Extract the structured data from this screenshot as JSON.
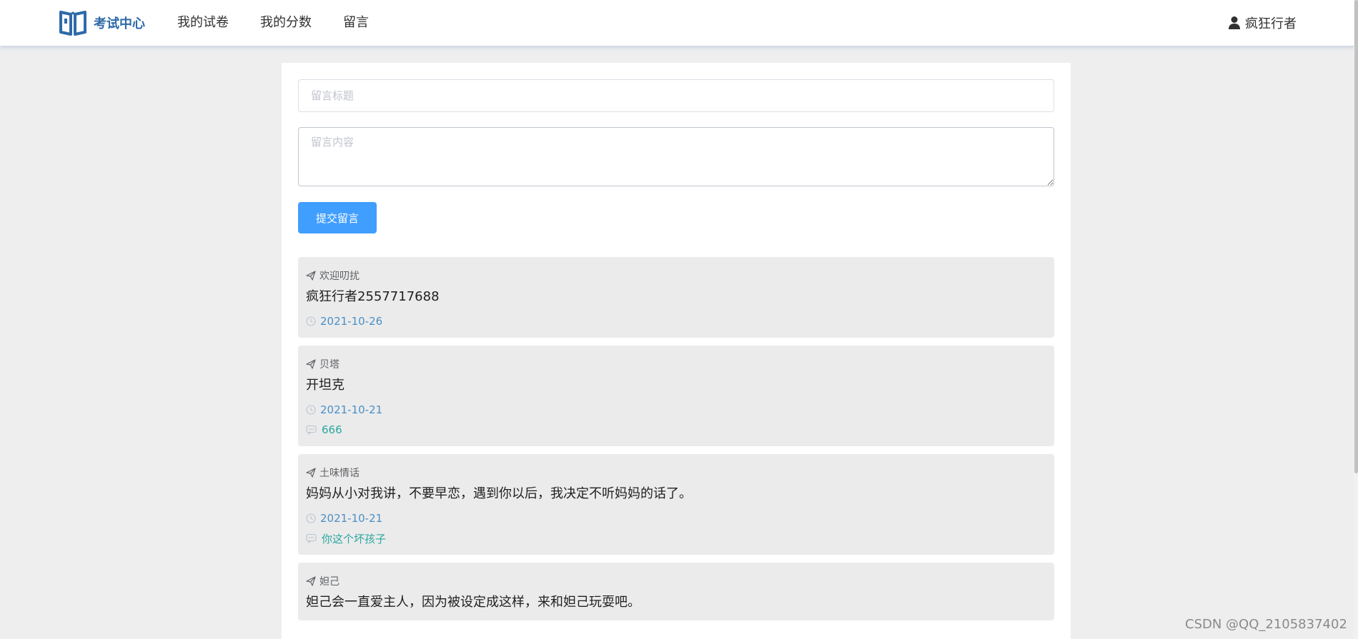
{
  "header": {
    "logo_text": "考试中心",
    "nav": [
      {
        "label": "我的试卷"
      },
      {
        "label": "我的分数"
      },
      {
        "label": "留言"
      }
    ],
    "user_name": "疯狂行者"
  },
  "form": {
    "title_placeholder": "留言标题",
    "content_placeholder": "留言内容",
    "submit_label": "提交留言"
  },
  "messages": [
    {
      "title": "欢迎叨扰",
      "content": "疯狂行者2557717688",
      "date": "2021-10-26"
    },
    {
      "title": "贝塔",
      "content": "开坦克",
      "date": "2021-10-21",
      "reply": "666"
    },
    {
      "title": "土味情话",
      "content": "妈妈从小对我讲，不要早恋，遇到你以后，我决定不听妈妈的话了。",
      "date": "2021-10-21",
      "reply": "你这个坏孩子"
    },
    {
      "title": "妲己",
      "content": "妲己会一直爱主人，因为被设定成这样，来和妲己玩耍吧。"
    }
  ],
  "watermark": "CSDN @QQ_2105837402",
  "colors": {
    "brand": "#2e6aa8",
    "primary_button": "#409eff",
    "date_text": "#4a8fc7",
    "reply_text": "#2aa7a0",
    "card_background": "#ebebeb",
    "page_background": "#eeeeee"
  },
  "icons": {
    "logo": "book-icon",
    "user": "user-icon",
    "message_title": "send-icon",
    "date": "clock-icon",
    "reply": "chat-bubble-icon"
  }
}
